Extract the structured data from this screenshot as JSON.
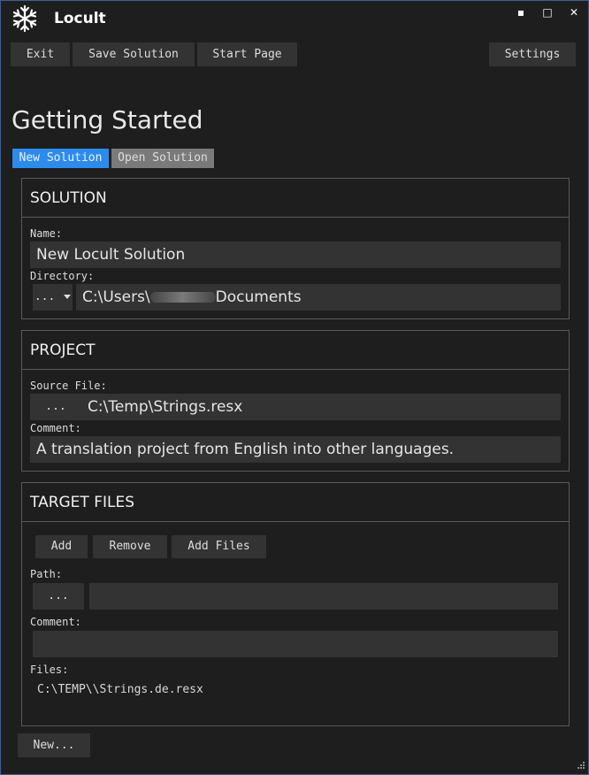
{
  "app": {
    "title": "Locult"
  },
  "window_controls": {
    "minimize": "▪",
    "maximize": "□",
    "close": "✕"
  },
  "toolbar": {
    "exit": "Exit",
    "save_solution": "Save Solution",
    "start_page": "Start Page",
    "settings": "Settings"
  },
  "page": {
    "heading": "Getting Started"
  },
  "tabs": [
    {
      "label": "New Solution",
      "active": true
    },
    {
      "label": "Open Solution",
      "active": false
    }
  ],
  "solution": {
    "header": "SOLUTION",
    "name_label": "Name:",
    "name_value": "New Locult Solution",
    "directory_label": "Directory:",
    "directory_button": "...",
    "directory_prefix": "C:\\Users\\",
    "directory_suffix": "Documents"
  },
  "project": {
    "header": "PROJECT",
    "source_label": "Source File:",
    "source_button": "...",
    "source_value": "C:\\Temp\\Strings.resx",
    "comment_label": "Comment:",
    "comment_value": "A translation project from English into other languages."
  },
  "target_files": {
    "header": "TARGET FILES",
    "add": "Add",
    "remove": "Remove",
    "add_files": "Add Files",
    "path_label": "Path:",
    "path_button": "...",
    "path_value": "",
    "comment_label": "Comment:",
    "comment_value": "",
    "files_label": "Files:",
    "files": [
      "C:\\TEMP\\\\Strings.de.resx"
    ]
  },
  "footer": {
    "new_button": "New..."
  },
  "colors": {
    "accent": "#2d8ceb",
    "background": "#1e1e1e",
    "control": "#333333",
    "border": "#5a5a5a"
  }
}
